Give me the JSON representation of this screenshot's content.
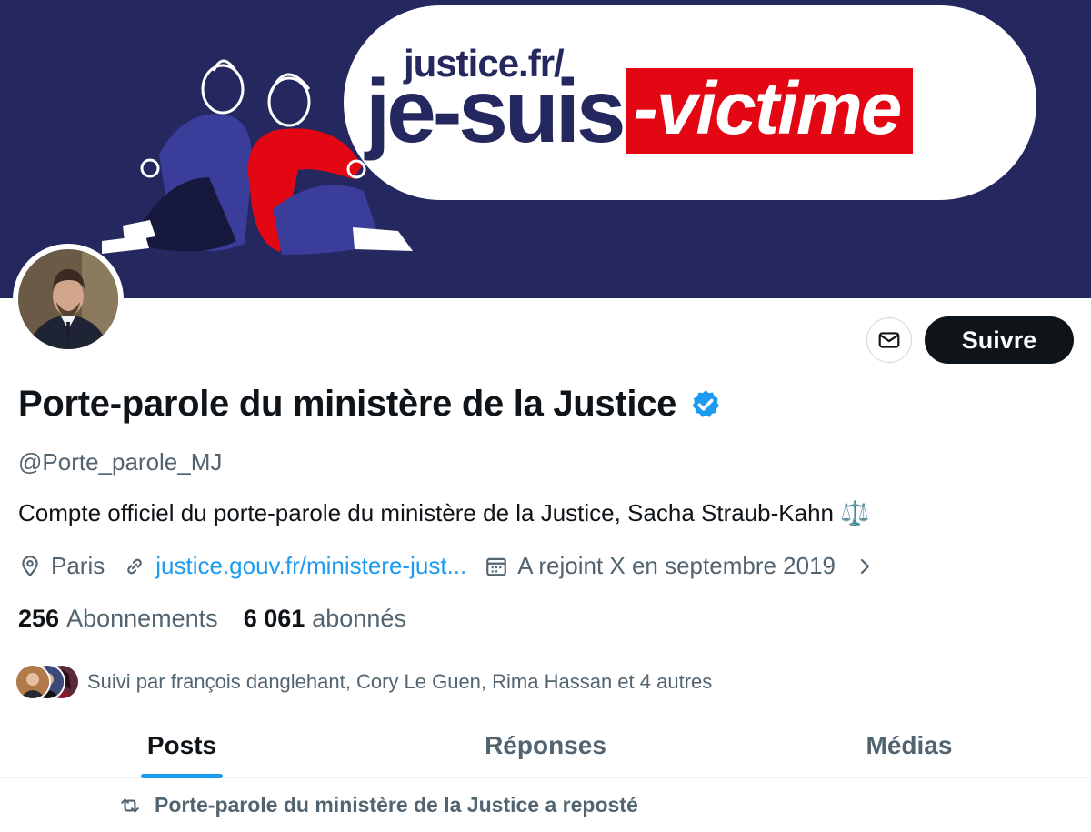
{
  "banner": {
    "url_text": "justice.fr/",
    "slogan_part1": "je-suis",
    "slogan_part2": "-victime"
  },
  "profile": {
    "display_name": "Porte-parole du ministère de la Justice",
    "handle": "@Porte_parole_MJ",
    "bio": "Compte officiel du porte-parole du ministère de la Justice, Sacha Straub-Kahn ⚖️",
    "location": "Paris",
    "website": "justice.gouv.fr/ministere-just...",
    "joined": "A rejoint X en septembre 2019",
    "following_count": "256",
    "following_label": "Abonnements",
    "followers_count": "6 061",
    "followers_label": "abonnés",
    "followed_by": "Suivi par françois danglehant, Cory Le Guen, Rima Hassan et 4 autres"
  },
  "actions": {
    "follow_label": "Suivre"
  },
  "tabs": [
    {
      "label": "Posts",
      "active": true
    },
    {
      "label": "Réponses",
      "active": false
    },
    {
      "label": "Médias",
      "active": false
    }
  ],
  "feed": {
    "repost_notice": "Porte-parole du ministère de la Justice a reposté"
  },
  "colors": {
    "banner_bg": "#25285f",
    "accent_red": "#e30613",
    "link_blue": "#1d9bf0",
    "follow_button_bg": "#0f1419",
    "muted_text": "#536471"
  }
}
